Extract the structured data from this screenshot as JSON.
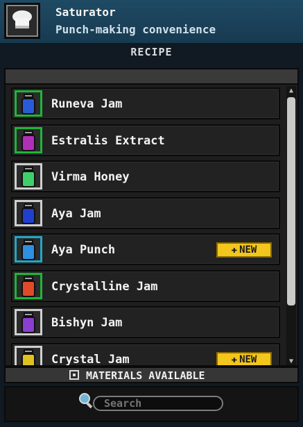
{
  "header": {
    "title": "Saturator",
    "subtitle": "Punch-making convenience",
    "icon": "chef-hat-icon"
  },
  "section_label": "RECIPE",
  "badge_label": "NEW",
  "recipes": [
    {
      "label": "Runeva Jam",
      "frame": "green",
      "jar_color": "#2a5bd6",
      "new": false
    },
    {
      "label": "Estralis Extract",
      "frame": "green",
      "jar_color": "#b02fb8",
      "new": false
    },
    {
      "label": "Virma Honey",
      "frame": "grey",
      "jar_color": "#3fcf6a",
      "new": false
    },
    {
      "label": "Aya Jam",
      "frame": "grey",
      "jar_color": "#1f3fcf",
      "new": false
    },
    {
      "label": "Aya Punch",
      "frame": "teal",
      "jar_color": "#2f8fe0",
      "new": true
    },
    {
      "label": "Crystalline Jam",
      "frame": "green",
      "jar_color": "#e04a2a",
      "new": false
    },
    {
      "label": "Bishyn Jam",
      "frame": "grey",
      "jar_color": "#8a3fd0",
      "new": false
    },
    {
      "label": "Crystal Jam",
      "frame": "grey",
      "jar_color": "#e0c21f",
      "new": true
    }
  ],
  "filter": {
    "label": "MATERIALS AVAILABLE",
    "checked": false
  },
  "search": {
    "placeholder": "Search"
  }
}
